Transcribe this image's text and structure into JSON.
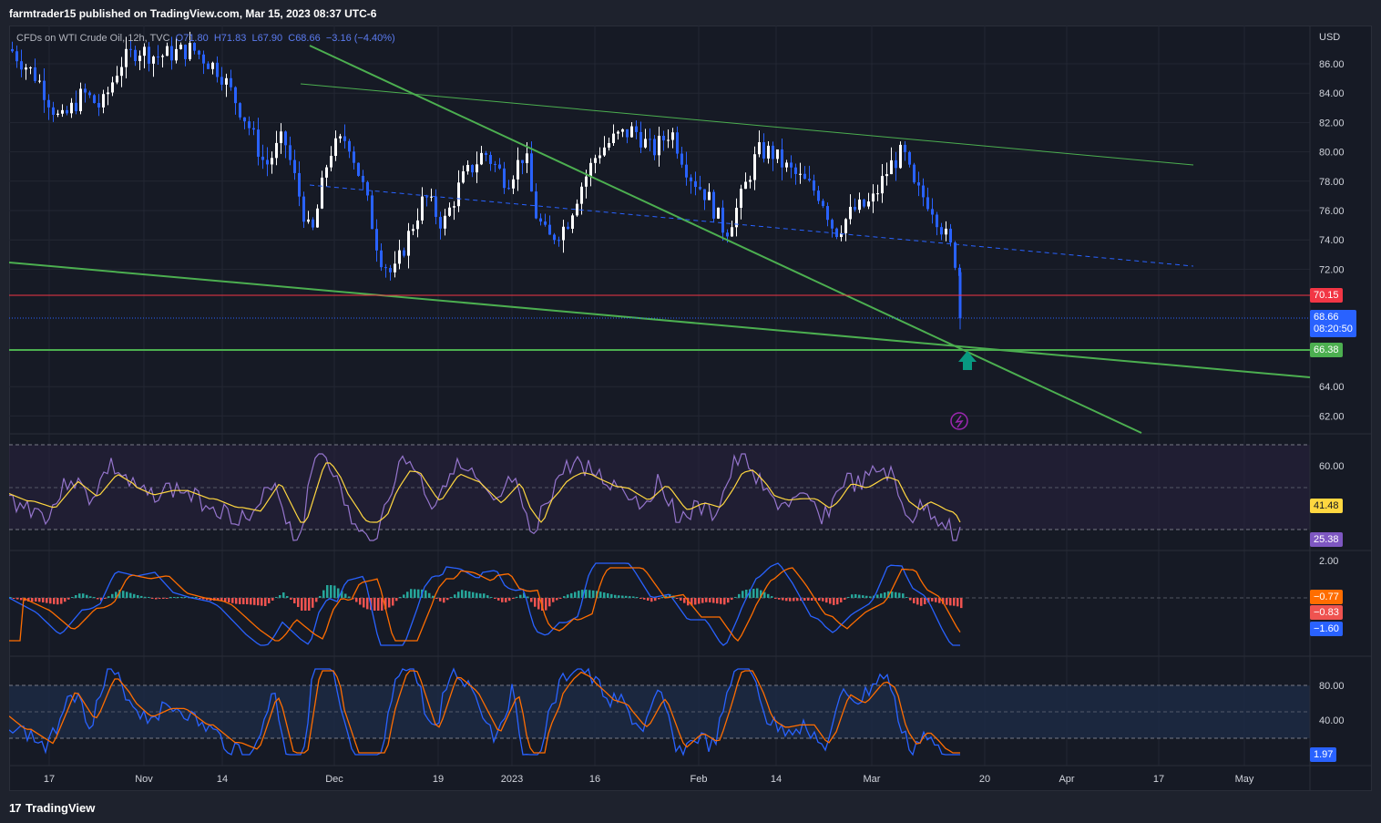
{
  "header": {
    "publisher": "farmtrader15 published on TradingView.com, Mar 15, 2023 08:37 UTC-6"
  },
  "symbol": {
    "name": "CFDs on WTI Crude Oil, 12h, TVC",
    "open": "O71.80",
    "high": "H71.83",
    "low": "L67.90",
    "close": "C68.66",
    "change": "−3.16 (−4.40%)"
  },
  "axis": {
    "currency": "USD",
    "price_ticks": [
      "86.00",
      "84.00",
      "82.00",
      "80.00",
      "78.00",
      "76.00",
      "74.00",
      "72.00",
      "64.00",
      "62.00"
    ],
    "rsi_ticks": [
      "60.00"
    ],
    "macd_ticks": [
      "2.00"
    ],
    "stoch_ticks": [
      "80.00",
      "40.00"
    ],
    "time_ticks": [
      "17",
      "Nov",
      "14",
      "Dec",
      "19",
      "2023",
      "16",
      "Feb",
      "14",
      "Mar",
      "20",
      "Apr",
      "17",
      "May"
    ]
  },
  "tags": {
    "resistance": "70.15",
    "last_price": "68.66",
    "countdown": "08:20:50",
    "support": "66.38",
    "rsi_ma": "41.48",
    "rsi": "25.38",
    "macd_signal": "−0.77",
    "macd_hist": "−0.83",
    "macd_line": "−1.60",
    "stoch": "1.97"
  },
  "colors": {
    "background": "#161a25",
    "up_candle": "#ffffff",
    "down_candle": "#2962ff",
    "trendline": "#4caf50",
    "resistance": "#f23645",
    "rsi_line": "#9575cd",
    "rsi_ma": "#ffd740",
    "macd_line": "#2962ff",
    "signal_line": "#ff6d00",
    "hist_pos": "#26a69a",
    "hist_neg": "#ef5350",
    "arrow": "#089981"
  },
  "icons": {
    "arrow": "arrow-up-icon",
    "lightning": "lightning-icon",
    "logo": "tradingview-logo-icon"
  },
  "footer": {
    "brand": "TradingView"
  }
}
